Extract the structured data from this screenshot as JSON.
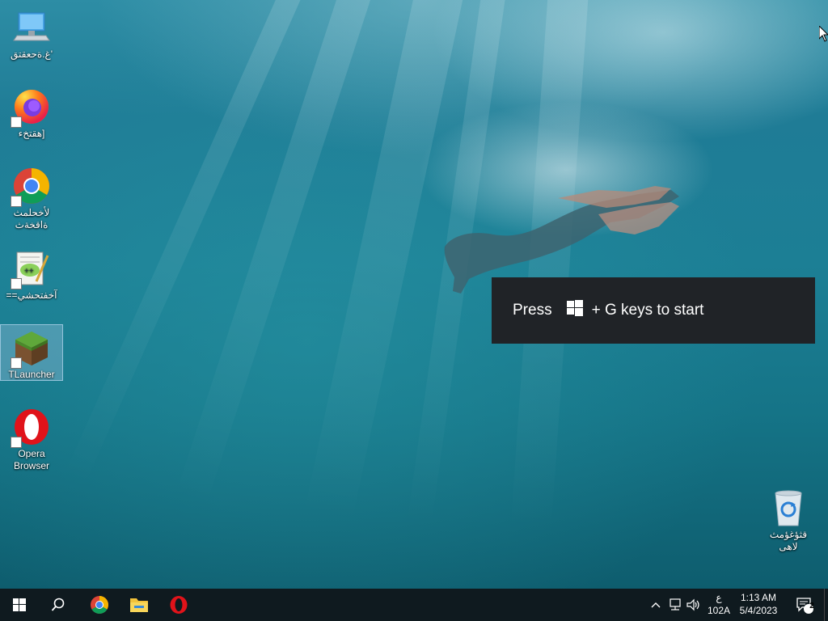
{
  "desktop": {
    "icons": [
      {
        "label": "غ.ةحعقتق'",
        "icon": "this-pc-icon"
      },
      {
        "label": "هقتخء]",
        "icon": "firefox-icon"
      },
      {
        "label": "لأخحلمث ةاقخةث",
        "icon": "chrome-icon"
      },
      {
        "label": "==آخفتحشي",
        "icon": "notepad-plus-plus-icon"
      },
      {
        "label": "TLauncher",
        "icon": "minecraft-grass-block-icon"
      },
      {
        "label": "Opera Browser",
        "icon": "opera-icon"
      },
      {
        "label": "قثؤغؤمث لاهى",
        "icon": "recycle-bin-icon"
      }
    ]
  },
  "toast": {
    "prefix": "Press",
    "suffix": "+ G keys to start",
    "icon": "windows-logo-icon"
  },
  "taskbar": {
    "pinned": [
      "start-button",
      "search-icon",
      "chrome-icon",
      "file-explorer-icon",
      "opera-icon"
    ],
    "tray": {
      "chevron": "^",
      "language_top": "ع",
      "language_bottom": "102A",
      "time": "1:13 AM",
      "date": "5/4/2023",
      "notification_count": "2"
    }
  },
  "colors": {
    "taskbar_bg": "#0f1a1f",
    "toast_bg": "#202327",
    "accent_windows": "#ffffff",
    "selection": "#aac8e6"
  }
}
